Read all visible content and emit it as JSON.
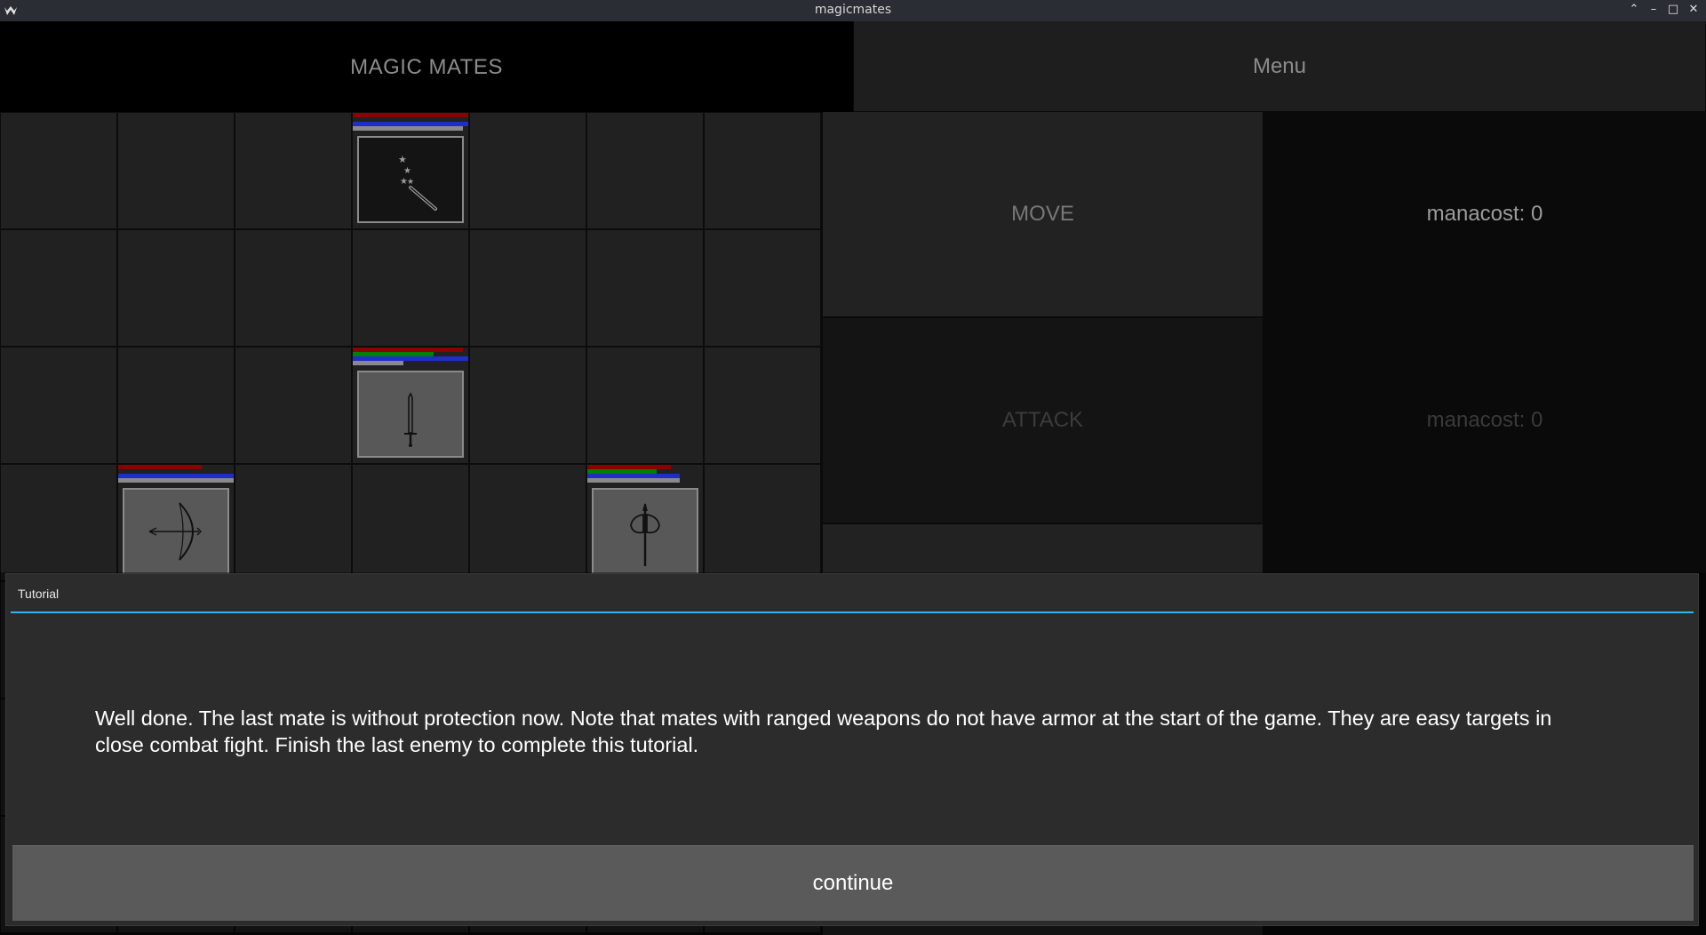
{
  "window": {
    "title": "magicmates"
  },
  "header": {
    "title": "MAGIC MATES",
    "menu_label": "Menu"
  },
  "actions": [
    {
      "label": "MOVE",
      "manacost": "manacost: 0",
      "active": true
    },
    {
      "label": "ATTACK",
      "manacost": "manacost: 0",
      "active": false
    }
  ],
  "units": [
    {
      "weapon": "wand",
      "row": 0,
      "col": 3,
      "bars": {
        "red": 1.0,
        "green": 0.0,
        "blue": 1.0,
        "gray": 0.95
      },
      "portrait_bg": "#141414"
    },
    {
      "weapon": "sword",
      "row": 2,
      "col": 3,
      "bars": {
        "red": 0.95,
        "green": 0.7,
        "blue": 1.0,
        "gray": 0.44
      },
      "portrait_bg": "#585858"
    },
    {
      "weapon": "bow",
      "row": 3,
      "col": 1,
      "bars": {
        "red": 0.72,
        "green": 0.0,
        "blue": 1.0,
        "gray": 1.0
      },
      "portrait_bg": "#585858"
    },
    {
      "weapon": "axe",
      "row": 3,
      "col": 5,
      "bars": {
        "red": 0.72,
        "green": 0.6,
        "blue": 0.8,
        "gray": 0.8
      },
      "portrait_bg": "#585858"
    }
  ],
  "dialog": {
    "title": "Tutorial",
    "message": "Well done. The last mate is without protection now. Note that mates with ranged weapons do not have armor at the start of the game. They are easy targets in close combat fight. Finish the last enemy to complete this tutorial.",
    "button_label": "continue"
  },
  "colors": {
    "accent": "#33b5e5",
    "bar_red": "#8b0000",
    "bar_green": "#008000",
    "bar_blue": "#1e2ec8",
    "bar_gray": "#8a8a8a"
  }
}
